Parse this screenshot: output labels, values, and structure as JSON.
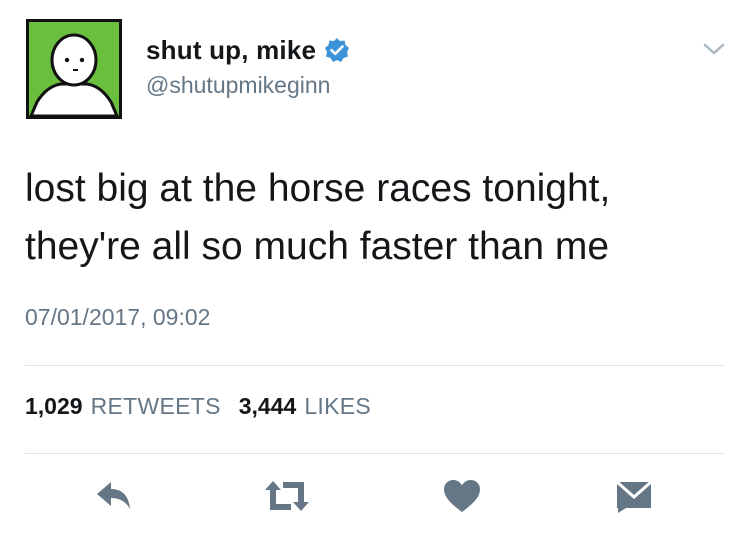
{
  "user": {
    "display_name": "shut up, mike",
    "handle": "@shutupmikeginn",
    "verified": true,
    "verified_color": "#3b94d9",
    "avatar_bg": "#6bbf3f"
  },
  "tweet": {
    "text_lines": [
      "lost big at the horse races tonight,",
      "they're all so much faster than me"
    ],
    "timestamp": "07/01/2017, 09:02"
  },
  "stats": {
    "retweets_count": "1,029",
    "retweets_label": "RETWEETS",
    "likes_count": "3,444",
    "likes_label": "LIKES"
  },
  "actions": [
    {
      "icon": "reply-icon"
    },
    {
      "icon": "retweet-icon"
    },
    {
      "icon": "heart-icon"
    },
    {
      "icon": "message-icon"
    }
  ],
  "colors": {
    "text": "#14171a",
    "secondary": "#657786",
    "icon": "#657786",
    "divider": "#dde3e8"
  }
}
